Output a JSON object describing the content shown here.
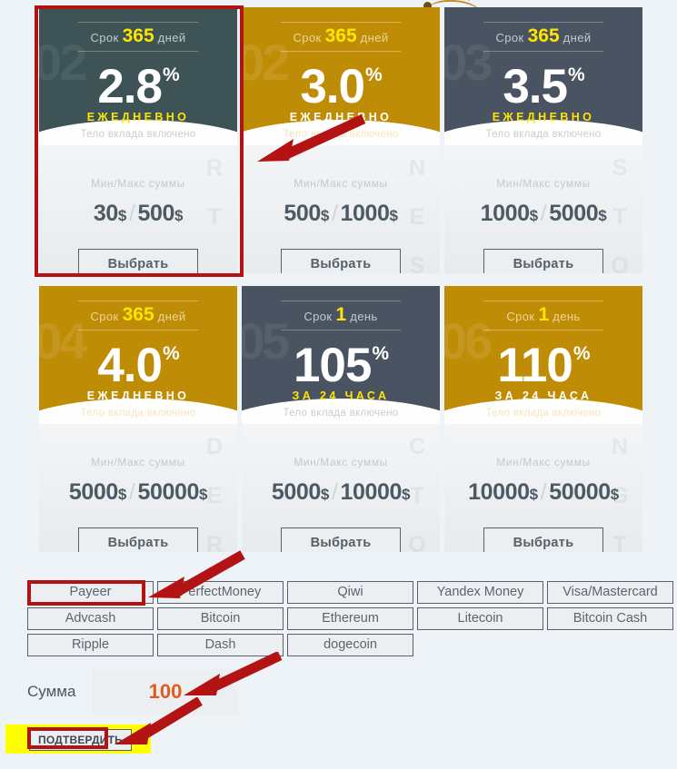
{
  "page": {
    "background_color": "#eef3f8",
    "accent_red": "#b31313",
    "highlight_yellow": "#ffff00",
    "gold": "#bf8c05",
    "dark_teal": "#3d5356",
    "dark_slate": "#4a5361",
    "amount_text_color": "#e25a1c"
  },
  "labels": {
    "term_prefix": "Срок",
    "term_suffix_days": "дней",
    "term_suffix_day": "день",
    "daily": "ЕЖЕДНЕВНО",
    "per24h": "ЗА 24 ЧАСА",
    "principal_included": "Тело вклада включено",
    "minmax_label": "Мин/Макс суммы",
    "choose_button": "Выбрать",
    "amount_label": "Сумма",
    "submit_button": "ПОДТВЕРДИТЬ"
  },
  "plans": [
    {
      "term_value": "365",
      "term_suffix": "дней",
      "rate": "2.8",
      "percent_sign": "%",
      "period": "ЕЖЕДНЕВНО",
      "note": "Тело вклада включено",
      "minmax_label": "Мин/Макс суммы",
      "min": "30",
      "max": "500",
      "currency": "$",
      "button": "Выбрать",
      "theme": "dark-teal",
      "watermark_num": "02",
      "watermark_letters": "R T",
      "selected": true
    },
    {
      "term_value": "365",
      "term_suffix": "дней",
      "rate": "3.0",
      "percent_sign": "%",
      "period": "ЕЖЕДНЕВНО",
      "note": "Тело вклада включено",
      "minmax_label": "Мин/Макс суммы",
      "min": "500",
      "max": "1000",
      "currency": "$",
      "button": "Выбрать",
      "theme": "gold",
      "watermark_num": "02",
      "watermark_letters": "N E S S",
      "selected": false
    },
    {
      "term_value": "365",
      "term_suffix": "дней",
      "rate": "3.5",
      "percent_sign": "%",
      "period": "ЕЖЕДНЕВНО",
      "note": "Тело вклада включено",
      "minmax_label": "Мин/Макс суммы",
      "min": "1000",
      "max": "5000",
      "currency": "$",
      "button": "Выбрать",
      "theme": "dark-slate",
      "watermark_num": "03",
      "watermark_letters": "S T O R",
      "selected": false
    },
    {
      "term_value": "365",
      "term_suffix": "дней",
      "rate": "4.0",
      "percent_sign": "%",
      "period": "ЕЖЕДНЕВНО",
      "note": "Тело вклада включено",
      "minmax_label": "Мин/Макс суммы",
      "min": "5000",
      "max": "50000",
      "currency": "$",
      "button": "Выбрать",
      "theme": "gold",
      "watermark_num": "04",
      "watermark_letters": "D E R",
      "selected": false
    },
    {
      "term_value": "1",
      "term_suffix": "день",
      "rate": "105",
      "percent_sign": "%",
      "period": "ЗА 24 ЧАСА",
      "note": "Тело вклада включено",
      "minmax_label": "Мин/Макс суммы",
      "min": "5000",
      "max": "10000",
      "currency": "$",
      "button": "Выбрать",
      "theme": "dark-slate",
      "watermark_num": "05",
      "watermark_letters": "C T O R",
      "selected": false
    },
    {
      "term_value": "1",
      "term_suffix": "день",
      "rate": "110",
      "percent_sign": "%",
      "period": "ЗА 24 ЧАСА",
      "note": "Тело вклада включено",
      "minmax_label": "Мин/Макс суммы",
      "min": "10000",
      "max": "50000",
      "currency": "$",
      "button": "Выбрать",
      "theme": "gold",
      "watermark_num": "06",
      "watermark_letters": "N G T",
      "selected": false
    }
  ],
  "payment_methods": [
    {
      "label": "Payeer",
      "selected": true
    },
    {
      "label": "PerfectMoney",
      "selected": false
    },
    {
      "label": "Qiwi",
      "selected": false
    },
    {
      "label": "Yandex Money",
      "selected": false
    },
    {
      "label": "Visa/Mastercard",
      "selected": false
    },
    {
      "label": "Advcash",
      "selected": false
    },
    {
      "label": "Bitcoin",
      "selected": false
    },
    {
      "label": "Ethereum",
      "selected": false
    },
    {
      "label": "Litecoin",
      "selected": false
    },
    {
      "label": "Bitcoin Cash",
      "selected": false
    },
    {
      "label": "Ripple",
      "selected": false
    },
    {
      "label": "Dash",
      "selected": false
    },
    {
      "label": "dogecoin",
      "selected": false
    }
  ],
  "amount": {
    "label": "Сумма",
    "value": "100",
    "placeholder": "100"
  },
  "submit": {
    "label": "ПОДТВЕРДИТЬ"
  }
}
